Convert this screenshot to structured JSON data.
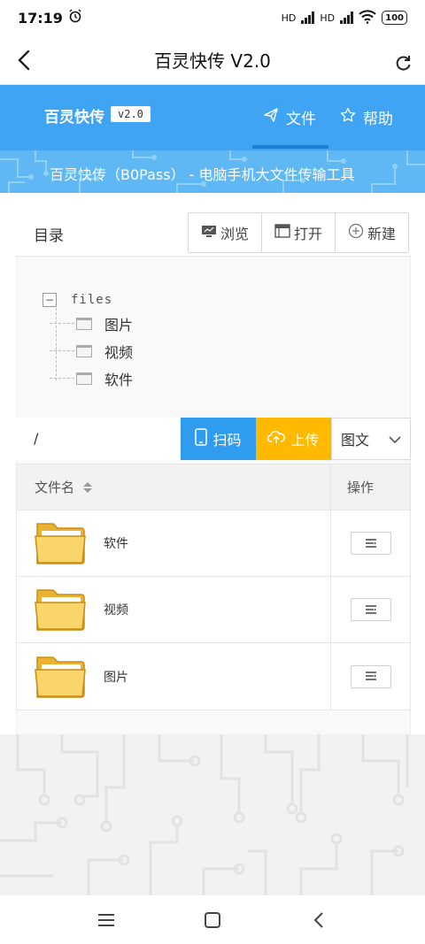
{
  "status": {
    "time": "17:19",
    "network1": "HD",
    "network2": "HD",
    "battery": "100"
  },
  "titlebar": {
    "title": "百灵快传 V2.0"
  },
  "nav": {
    "brand": "百灵快传",
    "version": "v2.0",
    "tab_file": "文件",
    "tab_help": "帮助",
    "accent": "#3fa4f4"
  },
  "banner": {
    "tagline": "百灵快传（B0Pass） - 电脑手机大文件传输工具"
  },
  "directory": {
    "label": "目录",
    "browse": "浏览",
    "open": "打开",
    "new": "新建"
  },
  "tree": {
    "toggle": "−",
    "root": "files",
    "children": [
      "图片",
      "视频",
      "软件"
    ]
  },
  "actions": {
    "path": "/",
    "scan": "扫码",
    "upload": "上传",
    "view": "图文"
  },
  "table": {
    "col_name": "文件名",
    "col_ops": "操作",
    "rows": [
      {
        "name": "软件"
      },
      {
        "name": "视频"
      },
      {
        "name": "图片"
      }
    ]
  }
}
